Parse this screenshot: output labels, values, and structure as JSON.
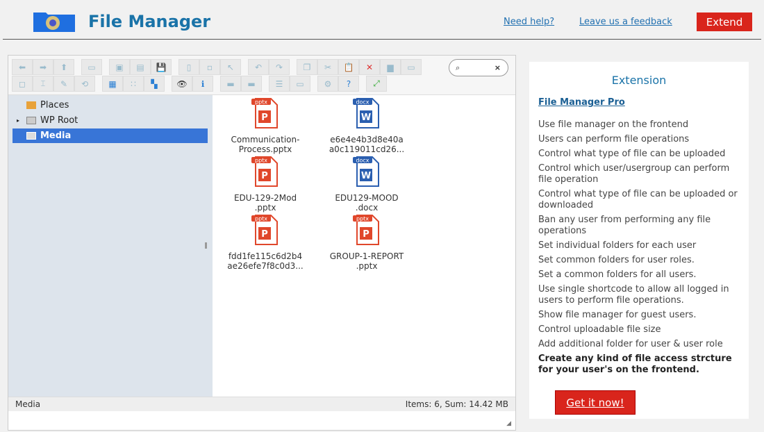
{
  "header": {
    "title": "File Manager",
    "help": "Need help?",
    "feedback": "Leave us a feedback",
    "extend": "Extend"
  },
  "toolbar": {
    "row1": [
      [
        "arrow-left",
        "arrow-right",
        "arrow-up"
      ],
      [
        "netmount"
      ],
      [
        "mkdir",
        "mkfile",
        "upload"
      ],
      [
        "open",
        "save",
        "select"
      ],
      [
        "undo",
        "redo"
      ],
      [
        "copy",
        "cut",
        "paste",
        "delete",
        "empty",
        "resize"
      ]
    ],
    "row2": [
      [
        "duplicate",
        "rename",
        "edit",
        "archive"
      ],
      [
        "view-icons",
        "view-small",
        "view-list"
      ],
      [
        "preview",
        "info"
      ],
      [
        "extract",
        "archive-add"
      ],
      [
        "sort",
        "places"
      ],
      [
        "settings",
        "help"
      ],
      [
        "fullscreen"
      ]
    ],
    "search_placeholder": "",
    "search_glyph": "⌕",
    "clear_glyph": "×"
  },
  "tree": [
    {
      "label": "Places"
    },
    {
      "label": "WP Root"
    },
    {
      "label": "Media"
    }
  ],
  "files": [
    {
      "name": "Communication-Process.pptx",
      "l1": "Communication-",
      "l2": "Process.pptx",
      "type": "pptx"
    },
    {
      "name": "e6e4e4b3d8e40a a0c119011cd26...",
      "l1": "e6e4e4b3d8e40a",
      "l2": "a0c119011cd26...",
      "type": "docx"
    },
    {
      "name": "EDU-129-2Mod.pptx",
      "l1": "EDU-129-2Mod",
      "l2": ".pptx",
      "type": "pptx"
    },
    {
      "name": "EDU129-MOOD.docx",
      "l1": "EDU129-MOOD",
      "l2": ".docx",
      "type": "docx"
    },
    {
      "name": "fdd1fe115c6d2b4ae26efe7f8c0d3...",
      "l1": "fdd1fe115c6d2b4",
      "l2": "ae26efe7f8c0d3...",
      "type": "pptx"
    },
    {
      "name": "GROUP-1-REPORT.pptx",
      "l1": "GROUP-1-REPORT",
      "l2": ".pptx",
      "type": "pptx"
    }
  ],
  "status": {
    "path": "Media",
    "summary": "Items: 6, Sum: 14.42 MB"
  },
  "extension": {
    "title": "Extension",
    "product": "File Manager Pro",
    "features": [
      "Use file manager on the frontend",
      "Users can perform file operations",
      "Control what type of file can be uploaded",
      "Control which user/usergroup can perform file operation",
      "Control what type of file can be uploaded or downloaded",
      "Ban any user from performing any file operations",
      "Set individual folders for each user",
      "Set common folders for user roles.",
      "Set a common folders for all users.",
      "Use single shortcode to allow all logged in users to perform file operations.",
      "Show file manager for guest users.",
      "Control uploadable file size",
      "Add additional folder for user & user role"
    ],
    "highlight": "Create any kind of file access strcture for your user's on the frontend.",
    "cta": "Get it now!"
  },
  "colors": {
    "accent": "#d9251c",
    "brand": "#1a73a8",
    "selection": "#3875d7",
    "pptx": "#e0472b",
    "docx": "#2b5fb0"
  }
}
